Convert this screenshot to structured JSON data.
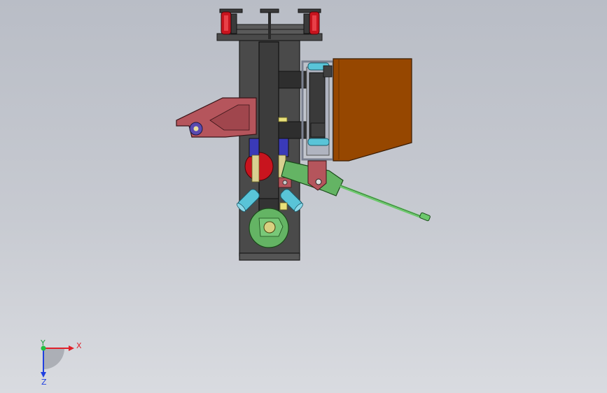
{
  "viewport": {
    "background_top": "#b9bdc6",
    "background_bottom": "#d9dbe0"
  },
  "triad": {
    "x_label": "X",
    "y_label": "Y",
    "z_label": "Z",
    "x_color": "#e0202a",
    "y_color": "#20c040",
    "z_color": "#2040e0"
  },
  "colors": {
    "frame": "#4a4a4a",
    "frame_dark": "#2e2e2e",
    "outline": "#1a1a1a",
    "bracket": "#b5555c",
    "motor_housing": "#964700",
    "wheel_red": "#c8141e",
    "roller": "#59c4d8",
    "cylinder": "#64b464",
    "cylinder_rod": "#6cc86c",
    "blue_block": "#3a3ab8",
    "guide_gray": "#9aa0b0",
    "yellow_stud": "#e8e07a"
  }
}
